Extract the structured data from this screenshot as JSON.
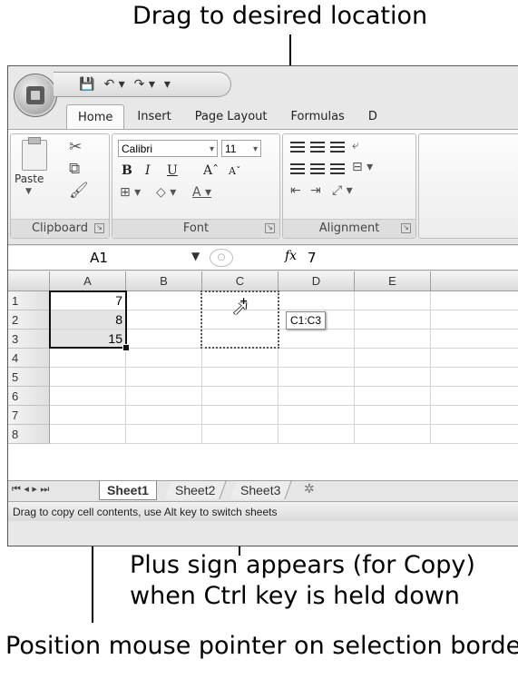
{
  "callouts": {
    "top": "Drag to desired location",
    "plus_line1": "Plus sign appears (for Copy)",
    "plus_line2": "when Ctrl key is held down",
    "bottom": "Position mouse pointer on selection border"
  },
  "qat": {
    "save": "💾",
    "undo": "↶ ▾",
    "redo": "↷ ▾",
    "customize": "▾"
  },
  "ribbon_tabs": [
    "Home",
    "Insert",
    "Page Layout",
    "Formulas",
    "D"
  ],
  "groups": {
    "clipboard": "Clipboard",
    "font": "Font",
    "alignment": "Alignment"
  },
  "paste_label": "Paste",
  "font_name": "Calibri",
  "font_size": "11",
  "format_buttons": {
    "bold": "B",
    "italic": "I",
    "underline": "U",
    "grow": "Aˆ",
    "shrink": "Aˇ"
  },
  "formula": {
    "namebox": "A1",
    "fx": "fx",
    "value": "7"
  },
  "columns": [
    "A",
    "B",
    "C",
    "D",
    "E"
  ],
  "rows": [
    "1",
    "2",
    "3",
    "4",
    "5",
    "6",
    "7",
    "8"
  ],
  "cells": {
    "A1": "7",
    "A2": "8",
    "A3": "15"
  },
  "tooltip": "C1:C3",
  "sheets": {
    "nav": "⏮ ◂ ▸ ⏭",
    "s1": "Sheet1",
    "s2": "Sheet2",
    "s3": "Sheet3",
    "new": "✲"
  },
  "status": "Drag to copy cell contents, use Alt key to switch sheets"
}
